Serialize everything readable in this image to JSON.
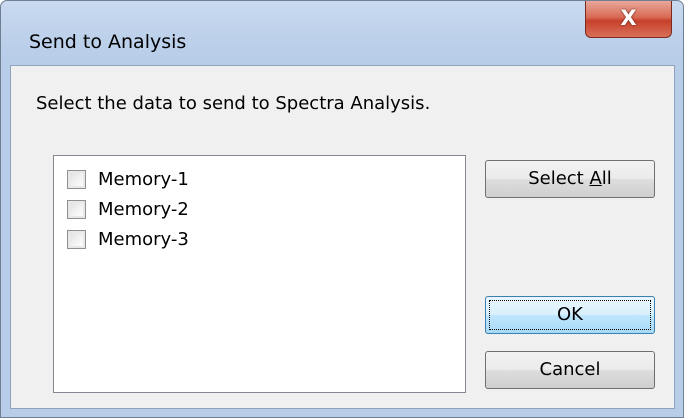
{
  "window": {
    "title": "Send to Analysis",
    "close_glyph": "X"
  },
  "dialog": {
    "prompt": "Select the data to send to Spectra Analysis.",
    "items": [
      {
        "label": "Memory-1",
        "checked": false
      },
      {
        "label": "Memory-2",
        "checked": false
      },
      {
        "label": "Memory-3",
        "checked": false
      }
    ],
    "buttons": {
      "select_all_prefix": "Select ",
      "select_all_accel": "A",
      "select_all_suffix": "ll",
      "ok": "OK",
      "cancel": "Cancel"
    }
  },
  "colors": {
    "title_bar": "#bcd0ea",
    "client_bg": "#f0f0f0",
    "close_button": "#c7402a",
    "default_button_border": "#3c7fb1"
  }
}
